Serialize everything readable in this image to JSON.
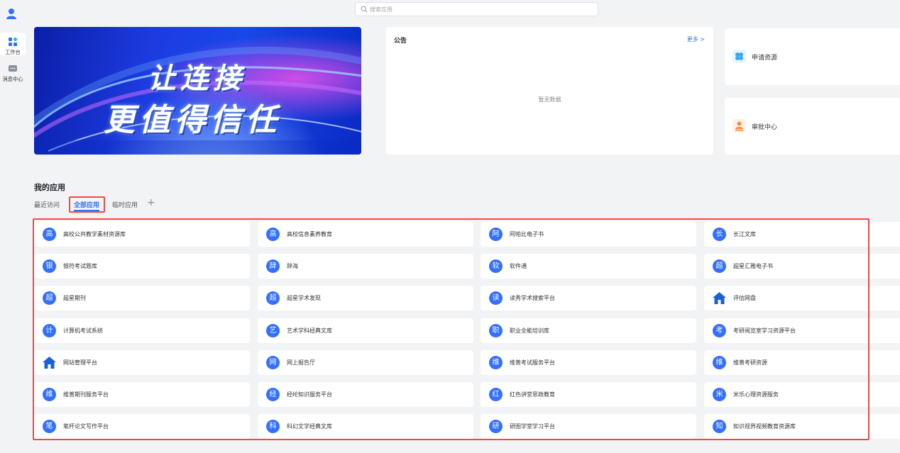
{
  "rail": {
    "items": [
      {
        "label": "工作台",
        "active": true
      },
      {
        "label": "消息中心",
        "active": false
      }
    ]
  },
  "search": {
    "placeholder": "搜索应用"
  },
  "banner": {
    "line1": "让连接",
    "line2": "更值得信任"
  },
  "notice": {
    "title": "公告",
    "more": "更多 >",
    "empty": "暂无数据"
  },
  "quick": [
    {
      "label": "申请资源",
      "color": "#3ba8f5"
    },
    {
      "label": "审批中心",
      "color": "#ff8a34"
    }
  ],
  "apps_section": {
    "title": "我的应用",
    "tabs": [
      {
        "label": "最近访问",
        "active": false
      },
      {
        "label": "全部应用",
        "active": true
      },
      {
        "label": "临时应用",
        "active": false
      }
    ],
    "add": "+"
  },
  "apps": [
    {
      "icon": "高",
      "label": "高校公共教学素材资源库"
    },
    {
      "icon": "高",
      "label": "高校信息素养教育"
    },
    {
      "icon": "阿",
      "label": "阿帕比电子书"
    },
    {
      "icon": "长",
      "label": "长江文库"
    },
    {
      "icon": "银",
      "label": "银符考试题库"
    },
    {
      "icon": "辞",
      "label": "辞海"
    },
    {
      "icon": "软",
      "label": "软件通"
    },
    {
      "icon": "超",
      "label": "超星汇雅电子书"
    },
    {
      "icon": "超",
      "label": "超星期刊"
    },
    {
      "icon": "超",
      "label": "超星学术发现"
    },
    {
      "icon": "读",
      "label": "读秀学术搜索平台"
    },
    {
      "icon": "home-icon",
      "label": "评估网盘"
    },
    {
      "icon": "计",
      "label": "计算机考试系统"
    },
    {
      "icon": "艺",
      "label": "艺术学科经典文库"
    },
    {
      "icon": "职",
      "label": "职业全能培训库"
    },
    {
      "icon": "考",
      "label": "考研阅览室学习资源平台"
    },
    {
      "icon": "home-icon",
      "label": "网站管理平台"
    },
    {
      "icon": "网",
      "label": "网上报告厅"
    },
    {
      "icon": "维",
      "label": "维普考试服务平台"
    },
    {
      "icon": "维",
      "label": "维普考研资源"
    },
    {
      "icon": "维",
      "label": "维普期刊服务平台"
    },
    {
      "icon": "经",
      "label": "经纶知识服务平台"
    },
    {
      "icon": "红",
      "label": "红色讲堂思政教育"
    },
    {
      "icon": "米",
      "label": "米乐心理资源服务"
    },
    {
      "icon": "笔",
      "label": "笔杆论文写作平台"
    },
    {
      "icon": "科",
      "label": "科幻文学经典文库"
    },
    {
      "icon": "研",
      "label": "研图学堂学习平台"
    },
    {
      "icon": "知",
      "label": "知识视界视频教育资源库"
    }
  ],
  "colors": {
    "accent": "#3370ff",
    "highlight": "#f0484f"
  }
}
